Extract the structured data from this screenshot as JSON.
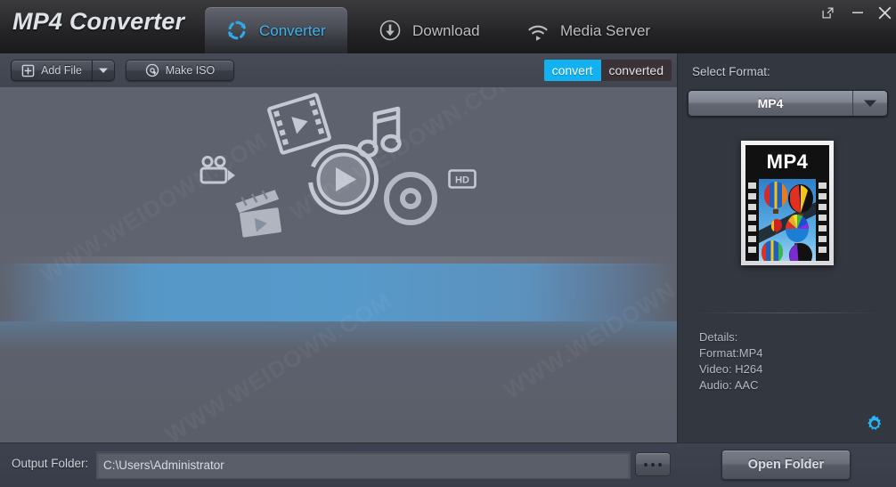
{
  "window": {
    "title": "MP4 Converter",
    "controls": [
      {
        "name": "restore-window-button",
        "glyph": "restore"
      },
      {
        "name": "minimize-window-button",
        "glyph": "minimize"
      },
      {
        "name": "close-window-button",
        "glyph": "close"
      }
    ]
  },
  "tabs": [
    {
      "label": "Converter",
      "icon": "refresh-circular-arrows-icon",
      "active": true
    },
    {
      "label": "Download",
      "icon": "download-arrow-circle-icon",
      "active": false
    },
    {
      "label": "Media Server",
      "icon": "wifi-broadcast-icon",
      "active": false
    }
  ],
  "toolbar": {
    "add_file_label": "Add File",
    "add_file_icon": "add-file-plus-icon",
    "add_file_dropdown_icon": "chevron-down-icon",
    "make_iso_label": "Make ISO",
    "make_iso_icon": "disc-burn-icon",
    "convert_tab_label": "convert",
    "converted_tab_label": "converted",
    "convert_active_color": "#12b1f0"
  },
  "stage": {
    "watermark": "WWW.WEIDOWN.COM",
    "icons": [
      {
        "name": "video-camera-icon"
      },
      {
        "name": "film-strip-play-icon"
      },
      {
        "name": "music-note-icon"
      },
      {
        "name": "clapperboard-icon"
      },
      {
        "name": "play-circle-icon"
      },
      {
        "name": "disc-icon"
      },
      {
        "name": "hd-badge-icon",
        "label": "HD"
      }
    ],
    "band_color": "#569acb"
  },
  "right_panel": {
    "select_format_label": "Select Format:",
    "selected_format": "MP4",
    "dropdown_icon": "chevron-down-icon",
    "thumbnail_label": "MP4",
    "details_title": "Details:",
    "details": [
      "Format:MP4",
      "Video: H264",
      "Audio: AAC"
    ],
    "settings_icon": "gear-icon",
    "background": "#33373f"
  },
  "bottom_bar": {
    "output_folder_label": "Output Folder:",
    "output_folder_value": "C:\\Users\\Administrator",
    "output_folder_placeholder": "C:\\Users\\Administrator",
    "browse_label": "...",
    "browse_icon": "ellipsis-icon",
    "open_folder_label": "Open Folder"
  }
}
